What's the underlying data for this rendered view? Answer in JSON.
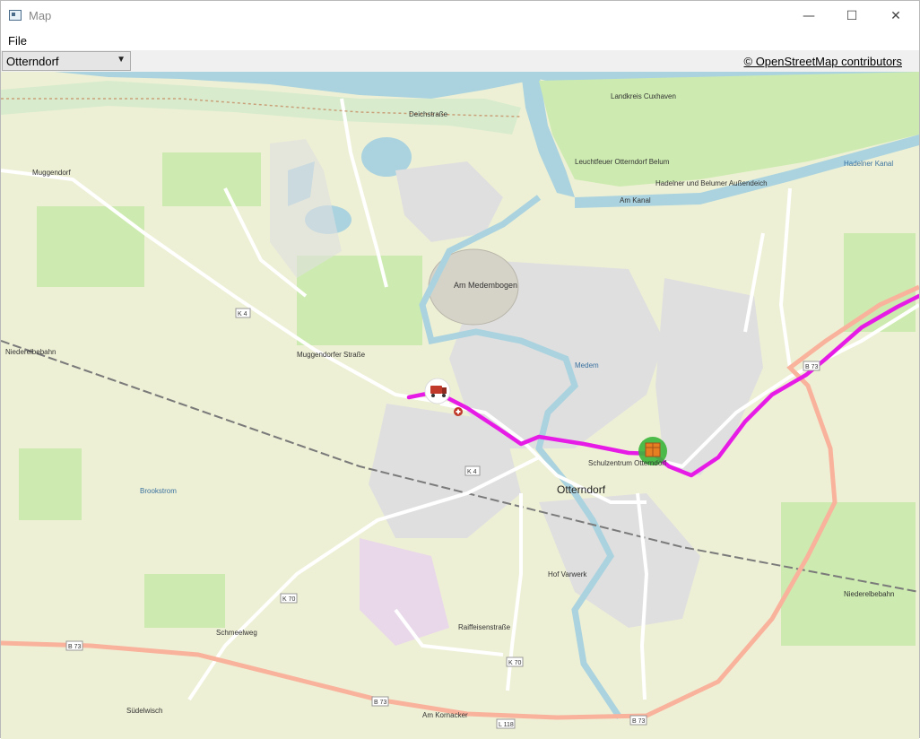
{
  "window": {
    "title": "Map",
    "minimize": "—",
    "maximize": "☐",
    "close": "✕"
  },
  "menu": {
    "file": "File"
  },
  "toolbar": {
    "location_selected": "Otterndorf",
    "attribution": "© OpenStreetMap contributors"
  },
  "map": {
    "town_label": "Otterndorf",
    "place_labels": {
      "muggendorf": "Muggendorf",
      "am_medembogen": "Am Medembogen",
      "schulzentrum": "Schulzentrum Otterndorf",
      "leuchtfeuer": "Leuchtfeuer Otterndorf Belum",
      "hadelner_kanal": "Hadelner Kanal",
      "hadelner_belumer": "Hadelner und Belumer Außendeich",
      "landkreis": "Landkreis Cuxhaven",
      "niederelbebahn_w": "Niederelbebahn",
      "niederelbebahn_e": "Niederelbebahn",
      "schmeelweg": "Schmeelweg",
      "suedelwisch": "Südelwisch",
      "brookstrom": "Brookstrom",
      "medem": "Medem",
      "am_kanal": "Am Kanal",
      "muggendorfer_strasse": "Muggendorfer Straße",
      "raiffeisenstrasse": "Raiffeisenstraße",
      "am_kornacker": "Am Kornacker",
      "hof_varwerk": "Hof Varwerk",
      "deichstrasse": "Deichstraße"
    },
    "road_labels": {
      "k4_west": "K 4",
      "k4_center": "K 4",
      "k70_south": "K 70",
      "k70_west": "K 70",
      "b73_west": "B 73",
      "b73_south": "B 73",
      "b73_east": "B 73",
      "b73_ne": "B 73",
      "l118": "L 118"
    },
    "colors": {
      "route": "#e61be6",
      "water": "#aad3df",
      "farmland": "#eef0d5",
      "meadow": "#cdebb0",
      "residential": "#e0dfdf",
      "trunk_road": "#f9b29c",
      "destination_marker": "#3ab53a"
    },
    "icons": {
      "origin": "truck-icon",
      "destination": "package-icon",
      "hospital": "hospital-icon"
    }
  }
}
